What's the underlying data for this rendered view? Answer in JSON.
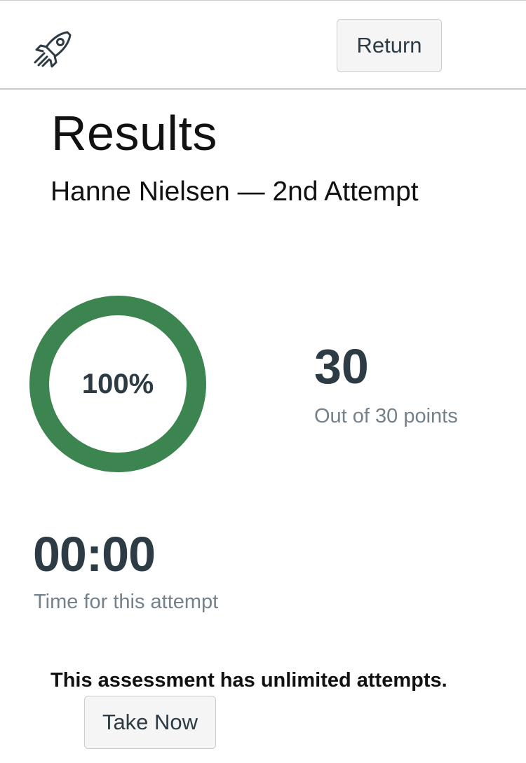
{
  "header": {
    "logo_icon": "rocket-icon",
    "return_label": "Return"
  },
  "results": {
    "title": "Results",
    "subtitle": "Hanne Nielsen — 2nd Attempt",
    "score_percent_text": "100%",
    "score_fraction": 1.0,
    "ring_color": "#3c8550",
    "points": "30",
    "points_caption": "Out of 30 points",
    "time": "00:00",
    "time_caption": "Time for this attempt"
  },
  "footer": {
    "attempts_note": "This assessment has unlimited attempts.",
    "take_now_label": "Take Now"
  }
}
